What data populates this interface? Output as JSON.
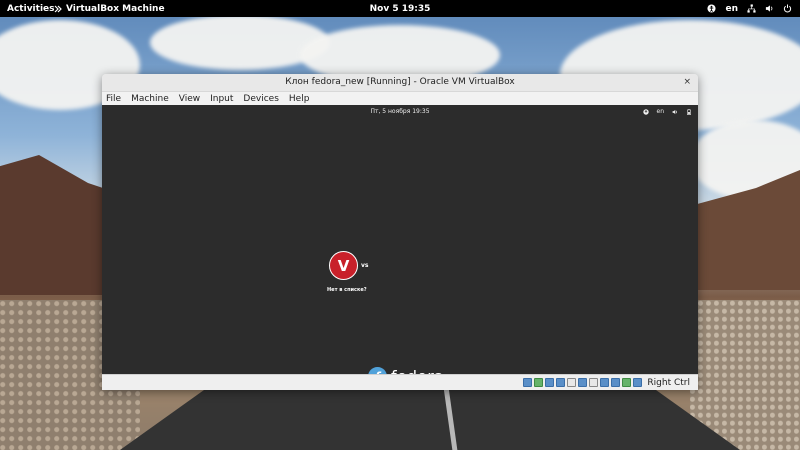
{
  "topbar": {
    "activities": "Activities",
    "app_name": "VirtualBox Machine",
    "clock": "Nov 5  19:35",
    "keyboard_layout": "en"
  },
  "vbox": {
    "title": "Клон fedora_new [Running] - Oracle VM VirtualBox",
    "close": "×",
    "menu": [
      "File",
      "Machine",
      "View",
      "Input",
      "Devices",
      "Help"
    ],
    "host_key": "Right Ctrl"
  },
  "guest": {
    "clock": "Пт, 5 ноября  19:35",
    "keyboard_layout": "en",
    "user_initial": "V",
    "username": "vs",
    "not_listed": "Нет в списке?",
    "brand": "fedora",
    "logo_glyph": "f"
  },
  "icons": {
    "accessibility": "accessibility-icon",
    "network": "network-icon",
    "volume": "volume-icon",
    "battery": "battery-icon",
    "power": "power-icon"
  },
  "colors": {
    "topbar": "#000000",
    "guest_bg": "#2c2c2c",
    "avatar": "#c8202a",
    "fedora_blue": "#51a2da"
  }
}
